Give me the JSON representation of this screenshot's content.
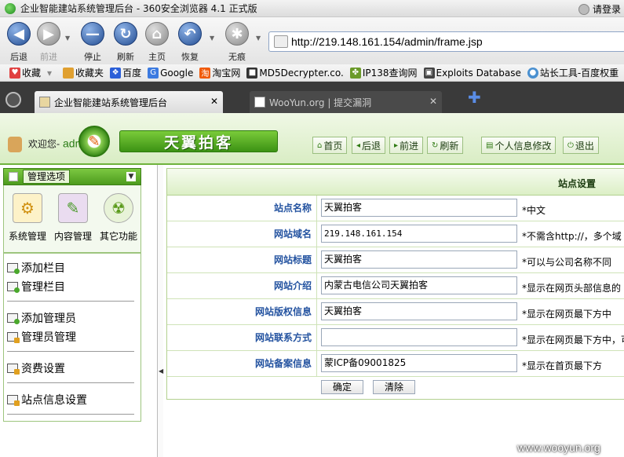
{
  "browser": {
    "window_title": "企业智能建站系统管理后台 - 360安全浏览器 4.1 正式版",
    "login_text": "请登录",
    "toolbar": {
      "back": "后退",
      "forward": "前进",
      "stop": "停止",
      "refresh": "刷新",
      "home": "主页",
      "restore": "恢复",
      "incognito": "无痕"
    },
    "address": "http://219.148.161.154/admin/frame.jsp",
    "favorites": [
      "收藏",
      "收藏夹",
      "百度",
      "Google",
      "淘宝网",
      "MD5Decrypter.co.",
      "IP138查询网",
      "Exploits Database",
      "站长工具-百度权重"
    ],
    "tabs": [
      {
        "label": "企业智能建站系统管理后台",
        "active": true
      },
      {
        "label": "WooYun.org | 提交漏洞",
        "active": false
      }
    ]
  },
  "header": {
    "welcome": "欢迎您-",
    "username": "admin",
    "site_name": "天翼拍客",
    "nav": {
      "home": "首页",
      "back": "后退",
      "forward": "前进",
      "refresh": "刷新",
      "profile": "个人信息修改",
      "logout": "退出"
    }
  },
  "sidebar": {
    "title": "管理选项",
    "modules": [
      "系统管理",
      "内容管理",
      "其它功能"
    ],
    "menu": [
      "添加栏目",
      "管理栏目",
      "添加管理员",
      "管理员管理",
      "资费设置",
      "站点信息设置"
    ]
  },
  "form": {
    "title": "站点设置",
    "rows": [
      {
        "label": "站点名称",
        "value": "天翼拍客",
        "hint": "*中文"
      },
      {
        "label": "网站域名",
        "value": "219.148.161.154",
        "hint": "*不需含http://，多个域"
      },
      {
        "label": "网站标题",
        "value": "天翼拍客",
        "hint": "*可以与公司名称不同"
      },
      {
        "label": "网站介绍",
        "value": "内蒙古电信公司天翼拍客",
        "hint": "*显示在网页头部信息的"
      },
      {
        "label": "网站版权信息",
        "value": "天翼拍客",
        "hint": "*显示在网页最下方中"
      },
      {
        "label": "网站联系方式",
        "value": "",
        "hint": "*显示在网页最下方中，可"
      },
      {
        "label": "网站备案信息",
        "value": "蒙ICP备09001825",
        "hint": "*显示在首页最下方"
      }
    ],
    "submit": "确定",
    "reset": "清除"
  },
  "watermark": "www.wooyun.org",
  "colors": {
    "accent_green": "#4d9b1e",
    "label_blue": "#2453a0"
  }
}
